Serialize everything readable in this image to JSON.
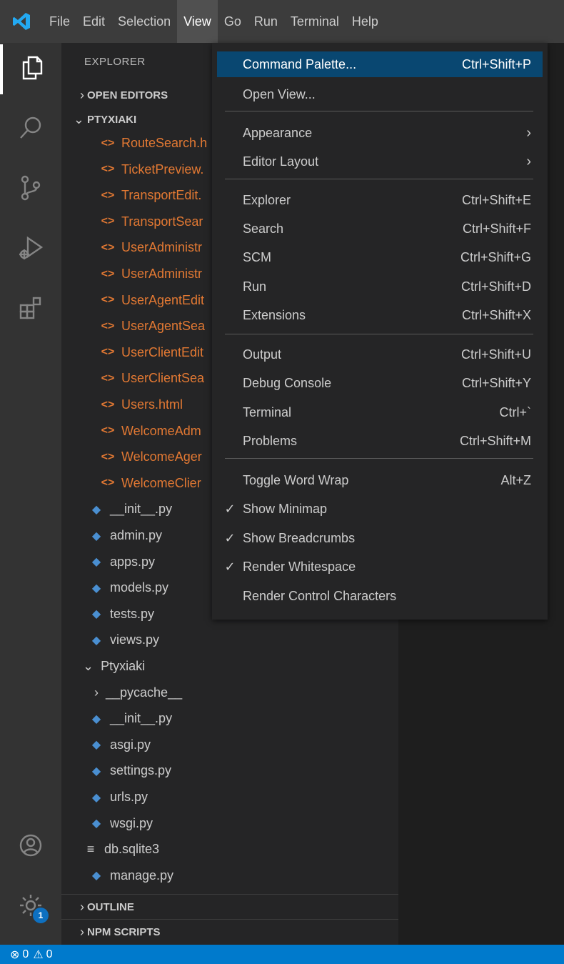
{
  "menubar": {
    "logo_icon": "vscode-logo-icon",
    "items": [
      "File",
      "Edit",
      "Selection",
      "View",
      "Go",
      "Run",
      "Terminal",
      "Help"
    ],
    "active": "View"
  },
  "activitybar": {
    "items": [
      "files-icon",
      "search-icon",
      "source-control-icon",
      "run-debug-icon",
      "extensions-icon"
    ],
    "bottom": [
      "account-icon",
      "settings-gear-icon"
    ],
    "settings_badge": "1"
  },
  "sidebar": {
    "title": "EXPLORER",
    "open_editors": "OPEN EDITORS",
    "project": "PTYXIAKI",
    "files": [
      {
        "name": "RouteSearch.h",
        "type": "html"
      },
      {
        "name": "TicketPreview.",
        "type": "html"
      },
      {
        "name": "TransportEdit.",
        "type": "html"
      },
      {
        "name": "TransportSear",
        "type": "html"
      },
      {
        "name": "UserAdministr",
        "type": "html"
      },
      {
        "name": "UserAdministr",
        "type": "html"
      },
      {
        "name": "UserAgentEdit",
        "type": "html"
      },
      {
        "name": "UserAgentSea",
        "type": "html"
      },
      {
        "name": "UserClientEdit",
        "type": "html"
      },
      {
        "name": "UserClientSea",
        "type": "html"
      },
      {
        "name": "Users.html",
        "type": "html"
      },
      {
        "name": "WelcomeAdm",
        "type": "html"
      },
      {
        "name": "WelcomeAger",
        "type": "html"
      },
      {
        "name": "WelcomeClier",
        "type": "html"
      },
      {
        "name": "__init__.py",
        "type": "py"
      },
      {
        "name": "admin.py",
        "type": "py"
      },
      {
        "name": "apps.py",
        "type": "py"
      },
      {
        "name": "models.py",
        "type": "py"
      },
      {
        "name": "tests.py",
        "type": "py"
      },
      {
        "name": "views.py",
        "type": "py"
      },
      {
        "name": "Ptyxiaki",
        "type": "folder-open"
      },
      {
        "name": "__pycache__",
        "type": "folder-closed"
      },
      {
        "name": "__init__.py",
        "type": "py"
      },
      {
        "name": "asgi.py",
        "type": "py"
      },
      {
        "name": "settings.py",
        "type": "py"
      },
      {
        "name": "urls.py",
        "type": "py"
      },
      {
        "name": "wsgi.py",
        "type": "py"
      },
      {
        "name": "db.sqlite3",
        "type": "db"
      },
      {
        "name": "manage.py",
        "type": "py"
      }
    ],
    "outline": "OUTLINE",
    "npm_scripts": "NPM SCRIPTS"
  },
  "view_menu": {
    "items": [
      {
        "label": "Command Palette...",
        "shortcut": "Ctrl+Shift+P"
      },
      {
        "label": "Open View...",
        "shortcut": ""
      },
      {
        "label": "Appearance",
        "shortcut": ""
      },
      {
        "label": "Editor Layout",
        "shortcut": ""
      },
      {
        "label": "Explorer",
        "shortcut": "Ctrl+Shift+E"
      },
      {
        "label": "Search",
        "shortcut": "Ctrl+Shift+F"
      },
      {
        "label": "SCM",
        "shortcut": "Ctrl+Shift+G"
      },
      {
        "label": "Run",
        "shortcut": "Ctrl+Shift+D"
      },
      {
        "label": "Extensions",
        "shortcut": "Ctrl+Shift+X"
      },
      {
        "label": "Output",
        "shortcut": "Ctrl+Shift+U"
      },
      {
        "label": "Debug Console",
        "shortcut": "Ctrl+Shift+Y"
      },
      {
        "label": "Terminal",
        "shortcut": "Ctrl+`"
      },
      {
        "label": "Problems",
        "shortcut": "Ctrl+Shift+M"
      },
      {
        "label": "Toggle Word Wrap",
        "shortcut": "Alt+Z"
      },
      {
        "label": "Show Minimap",
        "shortcut": "",
        "checked": true
      },
      {
        "label": "Show Breadcrumbs",
        "shortcut": "",
        "checked": true
      },
      {
        "label": "Render Whitespace",
        "shortcut": "",
        "checked": true
      },
      {
        "label": "Render Control Characters",
        "shortcut": ""
      }
    ]
  },
  "statusbar": {
    "errors": "0",
    "warnings": "0"
  },
  "colors": {
    "accent": "#007acc",
    "menu_highlight": "#094771",
    "html_file": "#e37933",
    "python_file": "#4a8fd1"
  }
}
